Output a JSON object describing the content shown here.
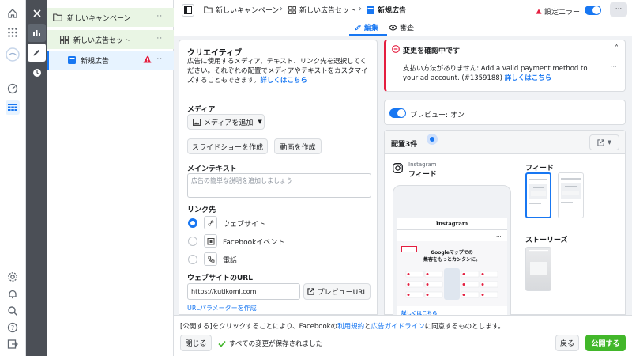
{
  "tree": {
    "campaign": "新しいキャンペーン",
    "adset": "新しい広告セット",
    "ad": "新規広告",
    "more": "···"
  },
  "topbar": {
    "crumb_campaign": "新しいキャンペーン",
    "crumb_adset": "新しい広告セット",
    "crumb_ad": "新規広告",
    "error_label": "設定エラー",
    "more": "···",
    "tab_edit": "編集",
    "tab_review": "審査"
  },
  "creative": {
    "title": "クリエイティブ",
    "desc": "広告に使用するメディア、テキスト、リンク先を選択してください。それぞれの配置でメディアやテキストをカスタマイズすることもできます。",
    "learn_more": "詳しくはこちら",
    "media_label": "メディア",
    "add_media": "メディアを追加",
    "slideshow": "スライドショーを作成",
    "video": "動画を作成",
    "main_text_label": "メインテキスト",
    "main_text_placeholder": "広告の簡単な説明を追加しましょう",
    "destination_label": "リンク先",
    "dest_website": "ウェブサイト",
    "dest_event": "Facebookイベント",
    "dest_phone": "電話",
    "url_label": "ウェブサイトのURL",
    "url_value": "https://kutikomi.com",
    "preview_url": "プレビューURL",
    "url_params": "URLパラメーターを作成"
  },
  "alert": {
    "title": "変更を確認中です",
    "message": "支払い方法がありません: Add a valid payment method to your ad account. (#1359188)",
    "learn_more": "詳しくはこちら",
    "more": "···"
  },
  "preview": {
    "toggle_label": "プレビュー: オン",
    "placements": "配置3件",
    "instagram": "Instagram",
    "feed": "フィード",
    "feed_section": "フィード",
    "stories_section": "ストーリーズ",
    "phone_brand": "Instagram",
    "ad_headline_1": "Googleマップでの",
    "ad_headline_2": "集客をもっとカンタンに。",
    "learn_more": "詳しくはこちら"
  },
  "footer": {
    "terms_prefix": "[公開する]をクリックすることにより、Facebookの",
    "terms_link1": "利用規約",
    "terms_and": "と",
    "terms_link2": "広告ガイドライン",
    "terms_suffix": "に同意するものとします。",
    "close": "閉じる",
    "saved": "すべての変更が保存されました",
    "back": "戻る",
    "publish": "公開する"
  },
  "colors": {
    "accent": "#1877f2",
    "error": "#e41e3f",
    "success": "#42b72a",
    "selected_tree": "#e7f3ff"
  }
}
